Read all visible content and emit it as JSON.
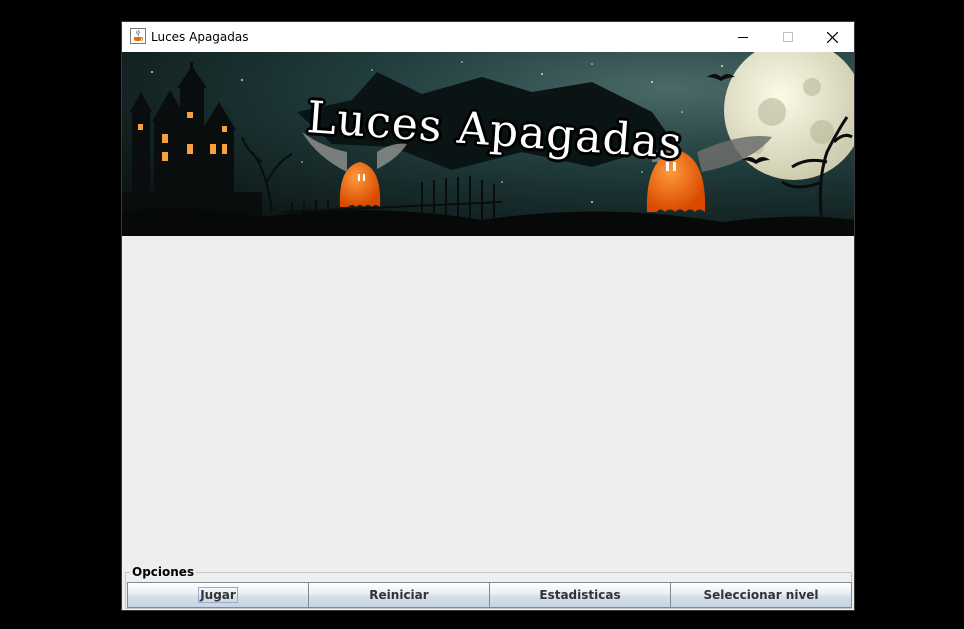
{
  "window": {
    "title": "Luces Apagadas",
    "app_icon": "java-cup-icon",
    "controls": [
      "minimize-icon",
      "maximize-icon",
      "close-icon"
    ]
  },
  "banner": {
    "title": "Luces Apagadas",
    "colors": {
      "sky": "#1e3a3a",
      "moon": "#e8e6c8",
      "ghost": "#f06a10"
    }
  },
  "options": {
    "legend": "Opciones",
    "buttons": [
      {
        "label": "Jugar",
        "focused": true
      },
      {
        "label": "Reiniciar"
      },
      {
        "label": "Estadisticas"
      },
      {
        "label": "Seleccionar nivel"
      }
    ]
  },
  "colors": {
    "background": "#eeeeee",
    "desktop": "#000000"
  }
}
